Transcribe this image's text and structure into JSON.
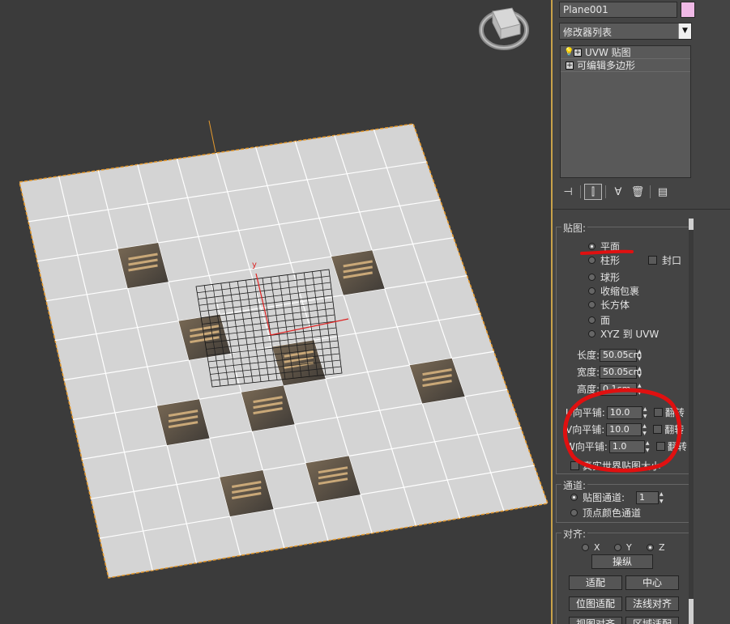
{
  "object_name": "Plane001",
  "object_color": "#f0b9e6",
  "modifier_list_label": "修改器列表",
  "modifier_stack": [
    {
      "label": "UVW 贴图",
      "icon": "lightbulb-icon"
    },
    {
      "label": "可编辑多边形",
      "icon": ""
    }
  ],
  "toolbar": {
    "icons": [
      "pin-stack-icon",
      "show-end-result-icon",
      "make-unique-icon",
      "remove-modifier-icon",
      "configure-modifier-sets-icon"
    ]
  },
  "mapping": {
    "title": "贴图:",
    "options": [
      {
        "label": "平面",
        "selected": true
      },
      {
        "label": "柱形",
        "selected": false
      },
      {
        "label": "球形",
        "selected": false
      },
      {
        "label": "收缩包裹",
        "selected": false
      },
      {
        "label": "长方体",
        "selected": false
      },
      {
        "label": "面",
        "selected": false
      },
      {
        "label": "XYZ 到 UVW",
        "selected": false
      }
    ],
    "cap_label": "封口",
    "length_label": "长度:",
    "length_value": "50.05cm",
    "width_label": "宽度:",
    "width_value": "50.05cm",
    "height_label": "高度:",
    "height_value": "0.1cm",
    "u_tile_label": "U向平铺:",
    "u_tile_value": "10.0",
    "v_tile_label": "V向平铺:",
    "v_tile_value": "10.0",
    "w_tile_label": "W向平铺:",
    "w_tile_value": "1.0",
    "flip_label": "翻转",
    "real_world_label": "真实世界贴图大小"
  },
  "channel": {
    "title": "通道:",
    "map_channel_label": "贴图通道:",
    "map_channel_value": "1",
    "vertex_color_label": "顶点颜色通道"
  },
  "alignment": {
    "title": "对齐:",
    "axes": [
      {
        "label": "X",
        "selected": false
      },
      {
        "label": "Y",
        "selected": false
      },
      {
        "label": "Z",
        "selected": true
      }
    ],
    "manipulate_label": "操纵",
    "fit_label": "适配",
    "center_label": "中心",
    "bitmap_fit_label": "位图适配",
    "normal_align_label": "法线对齐",
    "view_align_label": "视图对齐",
    "region_fit_label": "区域适配"
  },
  "annotation_color": "#e01010"
}
